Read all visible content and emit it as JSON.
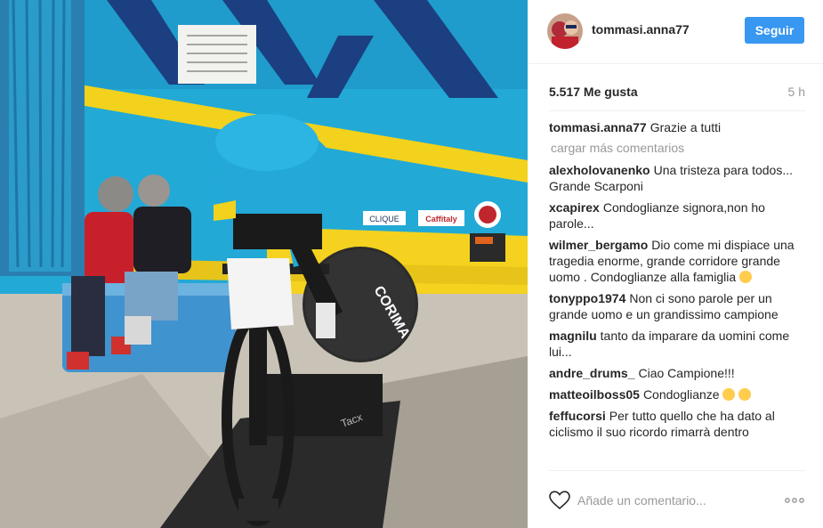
{
  "post": {
    "username": "tommasi.anna77",
    "follow_label": "Seguir",
    "likes": "5.517 Me gusta",
    "time": "5 h"
  },
  "photo": {
    "signs": [
      "CLIQUE",
      "Caffitaly",
      "CORIMA",
      "Tacx"
    ]
  },
  "caption": {
    "author": "tommasi.anna77",
    "text": "Grazie a tutti"
  },
  "load_more": "cargar más comentarios",
  "comments": [
    {
      "author": "alexholovanenko",
      "text": "Una tristeza para todos... Grande Scarponi"
    },
    {
      "author": "xcapirex",
      "text": "Condoglianze signora,non ho parole..."
    },
    {
      "author": "wilmer_bergamo",
      "text": "Dio come mi dispiace una tragedia enorme, grande corridore grande uomo . Condoglianze alla famiglia",
      "emojis": [
        "crying-face"
      ]
    },
    {
      "author": "tonyppo1974",
      "text": "Non ci sono parole per un grande uomo e un grandissimo campione"
    },
    {
      "author": "magnilu",
      "text": "tanto da imparare da uomini come lui..."
    },
    {
      "author": "andre_drums_",
      "text": "Ciao Campione!!!"
    },
    {
      "author": "matteoilboss05",
      "text": "Condoglianze",
      "emojis": [
        "crying-face",
        "loudly-crying-face"
      ]
    },
    {
      "author": "feffucorsi",
      "text": "Per tutto quello che ha dato al ciclismo il suo ricordo rimarrà dentro"
    }
  ],
  "add_comment": {
    "placeholder": "Añade un comentario..."
  },
  "icons": {
    "like": "heart-icon",
    "options": "more-options-icon"
  },
  "colors": {
    "follow": "#3897f0",
    "muted": "#999999",
    "text": "#262626",
    "bus": "#22a9d6"
  }
}
